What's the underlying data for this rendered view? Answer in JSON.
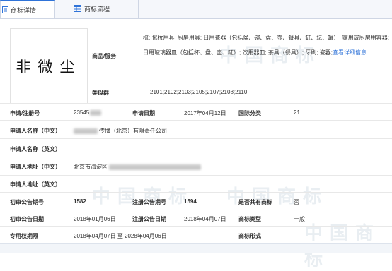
{
  "tabs": [
    {
      "label": "商标详情",
      "active": true
    },
    {
      "label": "商标流程",
      "active": false
    }
  ],
  "watermark_text": "中国商标",
  "logo_text": "非微尘",
  "goods": {
    "label": "商品/服务",
    "text": "梳; 化妆用具; 厨房用具; 日用瓷器（包括盆、碗、盘、壶、餐具、缸、坛、罐）; 家用或厨房用容器; 日用玻璃器皿（包括杯、盘、壶、缸）; 饮用器皿; 茶具（餐具）; 牙刷; 瓷器;",
    "link": "查看详细信息"
  },
  "similar_group": {
    "label": "类似群",
    "value": "2101;2102;2103;2105;2107;2108;2110;"
  },
  "fields": {
    "reg_no": {
      "label": "申请/注册号",
      "value": "23545"
    },
    "apply_date": {
      "label": "申请日期",
      "value": "2017年04月12日"
    },
    "intl_class": {
      "label": "国际分类",
      "value": "21"
    },
    "applicant_cn": {
      "label": "申请人名称（中文）",
      "value": "传播（北京）有限责任公司"
    },
    "applicant_en": {
      "label": "申请人名称（英文）",
      "value": ""
    },
    "address_cn": {
      "label": "申请人地址（中文）",
      "value": "北京市海淀区"
    },
    "address_en": {
      "label": "申请人地址（英文）",
      "value": ""
    },
    "prelim_no": {
      "label": "初审公告期号",
      "value": "1582"
    },
    "reg_pub_no": {
      "label": "注册公告期号",
      "value": "1594"
    },
    "shared": {
      "label": "是否共有商标",
      "value": "否"
    },
    "prelim_date": {
      "label": "初审公告日期",
      "value": "2018年01月06日"
    },
    "reg_pub_date": {
      "label": "注册公告日期",
      "value": "2018年04月07日"
    },
    "mark_type": {
      "label": "商标类型",
      "value": "一般"
    },
    "exclusive_period": {
      "label": "专用权期限",
      "value": "2018年04月07日 至 2028年04月06日"
    },
    "mark_form": {
      "label": "商标形式",
      "value": ""
    }
  }
}
